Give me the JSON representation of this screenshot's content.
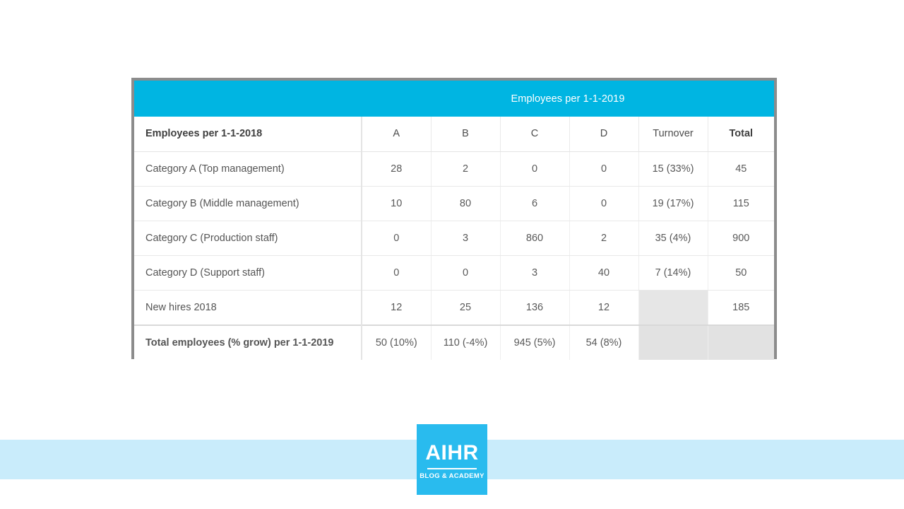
{
  "table": {
    "band": {
      "left_label": "",
      "title": "Employees per 1-1-2019"
    },
    "columns": [
      {
        "key": "label",
        "label": "Employees per 1-1-2018",
        "bold": true
      },
      {
        "key": "a",
        "label": "A",
        "bold": false
      },
      {
        "key": "b",
        "label": "B",
        "bold": false
      },
      {
        "key": "c",
        "label": "C",
        "bold": false
      },
      {
        "key": "d",
        "label": "D",
        "bold": false
      },
      {
        "key": "turnover",
        "label": "Turnover",
        "bold": false
      },
      {
        "key": "total",
        "label": "Total",
        "bold": true
      }
    ],
    "rows": [
      {
        "label": "Category A (Top management)",
        "a": "28",
        "b": "2",
        "c": "0",
        "d": "0",
        "turnover": "15 (33%)",
        "total": "45"
      },
      {
        "label": "Category B (Middle management)",
        "a": "10",
        "b": "80",
        "c": "6",
        "d": "0",
        "turnover": "19 (17%)",
        "total": "115"
      },
      {
        "label": "Category C (Production staff)",
        "a": "0",
        "b": "3",
        "c": "860",
        "d": "2",
        "turnover": "35 (4%)",
        "total": "900"
      },
      {
        "label": "Category D (Support staff)",
        "a": "0",
        "b": "0",
        "c": "3",
        "d": "40",
        "turnover": "7 (14%)",
        "total": "50"
      },
      {
        "label": "New hires 2018",
        "a": "12",
        "b": "25",
        "c": "136",
        "d": "12",
        "turnover": "",
        "total": "185"
      },
      {
        "label": "Total employees (% grow) per 1-1-2019",
        "a": "50 (10%)",
        "b": "110 (-4%)",
        "c": "945 (5%)",
        "d": "54 (8%)",
        "turnover": "",
        "total": ""
      }
    ]
  },
  "branding": {
    "logo_wordmark": "AIHR",
    "logo_tagline": "BLOG & ACADEMY"
  },
  "colors": {
    "accent_blue": "#00b5e2",
    "logo_blue": "#29bbee",
    "footer_band": "#c9ecfb",
    "table_border": "#8c8c8c",
    "empty_cell_grey": "#e6e6e6"
  }
}
